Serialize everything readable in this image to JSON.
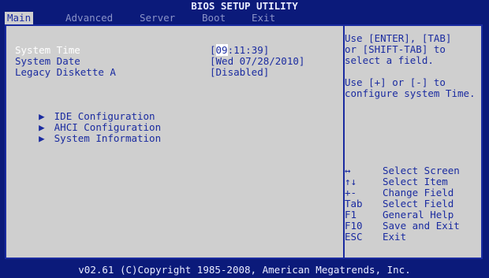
{
  "title": "BIOS SETUP UTILITY",
  "menu": {
    "main": "Main",
    "advanced": "Advanced",
    "server": "Server",
    "boot": "Boot",
    "exit": "Exit"
  },
  "settings": {
    "system_time": {
      "label": "System Time",
      "value_open": "[",
      "value_cursor": "09",
      "value_rest": ":11:39]"
    },
    "system_date": {
      "label": "System Date",
      "value": "[Wed 07/28/2010]"
    },
    "legacy_diskette": {
      "label": "Legacy Diskette A",
      "value": "[Disabled]"
    }
  },
  "submenus": [
    {
      "icon": "triangle-right-icon",
      "glyph": "▶",
      "label": "IDE Configuration"
    },
    {
      "icon": "triangle-right-icon",
      "glyph": "▶",
      "label": "AHCI Configuration"
    },
    {
      "icon": "triangle-right-icon",
      "glyph": "▶",
      "label": "System Information"
    }
  ],
  "help": {
    "line1": "Use [ENTER], [TAB]",
    "line2": "or [SHIFT-TAB] to",
    "line3": "select a field.",
    "line4": "Use [+] or [-] to",
    "line5": "configure system Time."
  },
  "keys": [
    {
      "key": "↔",
      "action": "Select Screen"
    },
    {
      "key": "↑↓",
      "action": "Select Item"
    },
    {
      "key": "+-",
      "action": "Change Field"
    },
    {
      "key": "Tab",
      "action": "Select Field"
    },
    {
      "key": "F1",
      "action": "General Help"
    },
    {
      "key": "F10",
      "action": "Save and Exit"
    },
    {
      "key": "ESC",
      "action": "Exit"
    }
  ],
  "footer": "v02.61 (C)Copyright 1985-2008, American Megatrends, Inc.",
  "colors": {
    "background": "#0b1a7a",
    "panel": "#cfcfcf",
    "text": "#1a2ba0",
    "selected": "#ffffff"
  }
}
